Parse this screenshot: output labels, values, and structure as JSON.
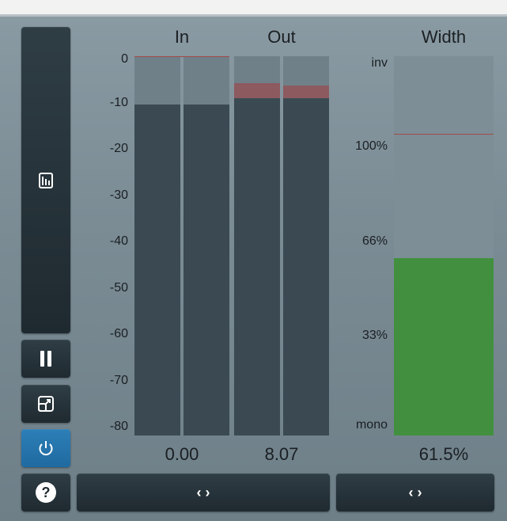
{
  "headers": {
    "in": "In",
    "out": "Out",
    "width": "Width"
  },
  "db_scale": [
    "0",
    "-10",
    "-20",
    "-30",
    "-40",
    "-50",
    "-60",
    "-70",
    "-80"
  ],
  "width_scale": [
    "inv",
    "100%",
    "66%",
    "33%",
    "mono"
  ],
  "readouts": {
    "in": "0.00",
    "out": "8.07",
    "width": "61.5%"
  },
  "meters": {
    "in_left_level": -10.5,
    "in_right_level": -10.5,
    "out_left_level": -9.0,
    "out_right_level": -9.0,
    "out_left_peak": -5.8,
    "out_right_peak": -6.4,
    "in_peak": 0,
    "width_level_percent": 61.5,
    "width_marker_percent": 100
  },
  "bottom_buttons": {
    "left_arrows": "‹ ›",
    "right_arrows": "‹ ›",
    "help": "?"
  },
  "colors": {
    "width_fill": "#42903f",
    "power_active": "#2a7ab3",
    "meter_fill": "#3b4a52",
    "clip": "#8c5a5f"
  },
  "icons": [
    "spectrum-icon",
    "pause-icon",
    "resize-icon",
    "power-icon",
    "help-icon"
  ]
}
